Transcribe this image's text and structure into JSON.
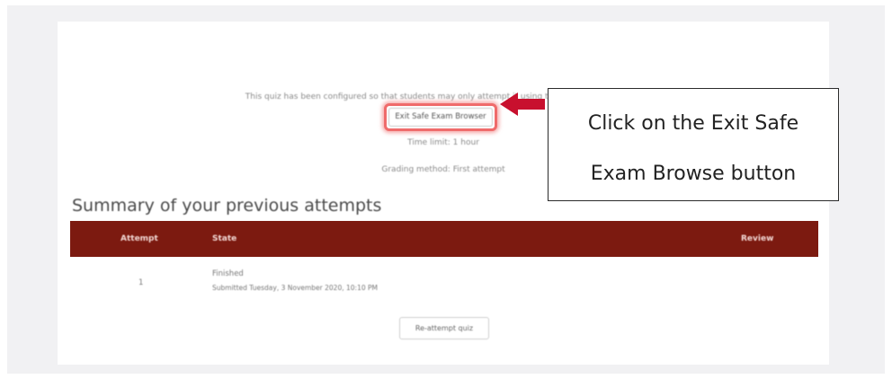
{
  "quiz": {
    "notice": "This quiz has been configured so that students may only attempt it using the Safe Exam Browser.",
    "exit_button_label": "Exit Safe Exam Browser",
    "time_limit": "Time limit: 1 hour",
    "grading_method": "Grading method: First attempt"
  },
  "summary": {
    "title": "Summary of your previous attempts",
    "columns": [
      "Attempt",
      "State",
      "Review"
    ],
    "rows": [
      {
        "attempt": "1",
        "state": "Finished",
        "submitted": "Submitted Tuesday, 3 November 2020, 10:10 PM"
      }
    ],
    "header_color": "#7c1a10"
  },
  "reattempt_label": "Re-attempt quiz",
  "callout": {
    "line1": "Click on the Exit Safe",
    "line2": "Exam Browse button",
    "arrow_color": "#c8102e"
  }
}
